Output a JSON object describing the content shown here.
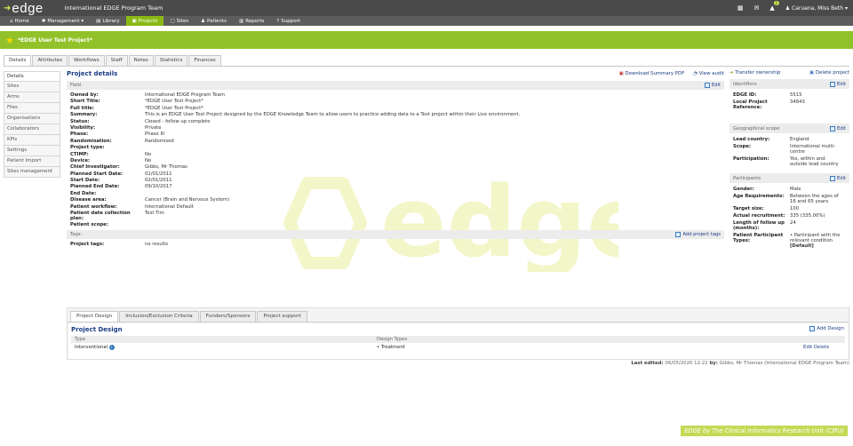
{
  "header": {
    "logo_text": "edge",
    "app_title": "International EDGE Program Team",
    "notifications_count": "2",
    "user_name": "Caruana, Miss Beth ▾"
  },
  "nav": [
    {
      "icon": "home-icon",
      "glyph": "⌂",
      "label": "Home"
    },
    {
      "icon": "management-icon",
      "glyph": "✱",
      "label": "Management ▾"
    },
    {
      "icon": "library-icon",
      "glyph": "▤",
      "label": "Library"
    },
    {
      "icon": "projects-icon",
      "glyph": "▣",
      "label": "Projects",
      "active": true
    },
    {
      "icon": "sites-icon",
      "glyph": "▢",
      "label": "Sites"
    },
    {
      "icon": "patients-icon",
      "glyph": "♟",
      "label": "Patients"
    },
    {
      "icon": "reports-icon",
      "glyph": "▥",
      "label": "Reports"
    },
    {
      "icon": "support-icon",
      "glyph": "?",
      "label": "Support"
    }
  ],
  "project_title": "*EDGE User Test Project*",
  "tabs": [
    "Details",
    "Attributes",
    "Workflows",
    "Staff",
    "Notes",
    "Statistics",
    "Finances"
  ],
  "side_menu": [
    "Details",
    "Sites",
    "Arms",
    "Files",
    "Organisations",
    "Collaborators",
    "KPIs",
    "Settings",
    "Patient Import",
    "Sites management"
  ],
  "details": {
    "title": "Project details",
    "download_pdf": "Download Summary PDF",
    "view_audit": "View audit",
    "field_header": "Field",
    "edit": "Edit",
    "rows": [
      {
        "k": "Owned by:",
        "v": "International EDGE Program Team",
        "link": true
      },
      {
        "k": "Short Title:",
        "v": "*EDGE User Test Project*"
      },
      {
        "k": "Full title:",
        "v": "*EDGE User Test Project*"
      },
      {
        "k": "Summary:",
        "v": "This is an EDGE User Test Project designed by the EDGE Knowledge Team to allow users to practice adding data to a Test project within their Live environment."
      },
      {
        "k": "Status:",
        "v": "Closed - follow up complete"
      },
      {
        "k": "Visibility:",
        "v": "Private"
      },
      {
        "k": "Phase:",
        "v": "Phase III"
      },
      {
        "k": "Randomisation:",
        "v": "Randomised"
      },
      {
        "k": "Project type:",
        "v": ""
      },
      {
        "k": "CTIMP:",
        "v": "No"
      },
      {
        "k": "Device:",
        "v": "No"
      },
      {
        "k": "Chief Investigator:",
        "v": "Gibbs, Mr Thomas",
        "link": true
      },
      {
        "k": "Planned Start Date:",
        "v": "01/01/2011"
      },
      {
        "k": "Start Date:",
        "v": "02/01/2011"
      },
      {
        "k": "Planned End Date:",
        "v": "09/10/2017"
      },
      {
        "k": "End Date:",
        "v": ""
      },
      {
        "k": "Disease area:",
        "v": "Cancer (Brain and Nervous System)"
      },
      {
        "k": "Patient workflow:",
        "v": "International Default",
        "link": true
      }
    ],
    "collection_plan_label": "Patient date collection plan:",
    "collection_plan_value": "Test Tim",
    "patient_scope_label": "Patient scope:",
    "tags_label": "Tags:",
    "add_tags": "Add project tags",
    "project_tags_label": "Project tags:",
    "project_tags_value": "no results"
  },
  "right": {
    "transfer": "Transfer ownership",
    "delete": "Delete project",
    "identifiers_title": "Identifiers",
    "edit": "Edit",
    "edge_id_label": "EDGE ID:",
    "edge_id_value": "5515",
    "local_ref_label": "Local Project Reference:",
    "local_ref_value": "34843",
    "geo_title": "Geographical scope",
    "lead_country_label": "Lead country:",
    "lead_country_value": "England",
    "scope_label": "Scope:",
    "scope_value": "International multi-centre",
    "participation_label": "Participation:",
    "participation_value": "Yes, within and outside lead country",
    "participants_title": "Participants",
    "gender_label": "Gender:",
    "gender_value": "Male",
    "age_label": "Age Requirements:",
    "age_value": "Between the ages of 16 and 65 years",
    "target_label": "Target size:",
    "target_value": "100",
    "actual_label": "Actual recruitment:",
    "actual_value": "335 (335.00%)",
    "followup_label": "Length of follow up (months):",
    "followup_value": "24",
    "ptypes_label": "Patient Participant Types:",
    "ptypes_value": "Participant with the relevant condition",
    "ptypes_default": "[Default]"
  },
  "lower": {
    "tabs": [
      "Project Design",
      "Inclusion/Exclusion Criteria",
      "Funders/Sponsors",
      "Project support"
    ],
    "title": "Project Design",
    "add": "Add Design",
    "col_type": "Type",
    "col_design": "Design Types",
    "type_value": "Interventional",
    "design_value": "Treatment",
    "edit": "Edit",
    "delete": "Delete"
  },
  "last_edited": {
    "label": "Last edited:",
    "date": "06/05/2020 12:22",
    "by_label": "by:",
    "by_value": "Gibbs, Mr Thomas (International EDGE Program Team)"
  },
  "footer": "EDGE by The Clinical Informatics Research Unit (CIRU)",
  "colors": {
    "accent": "#92c22a",
    "header": "#4a4a4a",
    "link": "#1b3d86"
  }
}
